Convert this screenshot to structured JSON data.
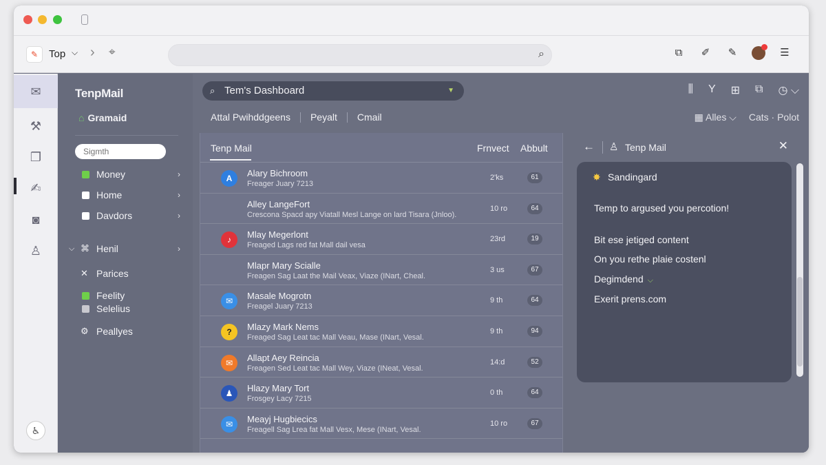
{
  "browser": {
    "tab_title": "Top",
    "tab_icon": "temp-mail-favicon",
    "url_value": ""
  },
  "sidebar": {
    "app_title": "TenpMail",
    "account": "Gramaid",
    "search_placeholder": "Sigmth",
    "items": [
      {
        "label": "Money",
        "color": "#6fcf4a"
      },
      {
        "label": "Home",
        "color": "#ffffff"
      },
      {
        "label": "Davdors",
        "color": "#ffffff"
      },
      {
        "label": "Henil"
      },
      {
        "label": "Parices"
      },
      {
        "label": "Feelity",
        "color": "#6fcf4a"
      },
      {
        "label": "Selelius",
        "color": "#c9c9cf"
      },
      {
        "label": "Peallyes"
      }
    ]
  },
  "header": {
    "dashboard": "Tem's Dashboard",
    "filters": [
      "Attal Pwihddgeens",
      "Peyalt",
      "Cmail"
    ],
    "right_filter": "Alles",
    "right_link": "Cats · Polot"
  },
  "list": {
    "title": "Tenp Mail",
    "col1": "Frnvect",
    "col2": "Abbult",
    "rows": [
      {
        "sender": "Alary Bichroom",
        "preview": "Freager Juary 7213",
        "time": "2'ks",
        "badge": "61",
        "avatar_color": "#2f7fe0",
        "avatar_text": "A"
      },
      {
        "sender": "Alley LangeFort",
        "preview": "Crescona Spacd apy Viatall Mesl Lange on lard Tisara (Jnloo).",
        "time": "10 ro",
        "badge": "64",
        "avatar_color": "",
        "avatar_text": ""
      },
      {
        "sender": "Mlay Megerlont",
        "preview": "Freaged Lags red fat Mall dail vesa",
        "time": "23rd",
        "badge": "19",
        "avatar_color": "#e0333a",
        "avatar_text": "♪"
      },
      {
        "sender": "Mlapr Mary Scialle",
        "preview": "Freagen Sag Laat the Mail Veax, Viaze (INart, Cheal.",
        "time": "3 us",
        "badge": "67",
        "avatar_color": "",
        "avatar_text": ""
      },
      {
        "sender": "Masale Mogrotn",
        "preview": "Freagel Juary 7213",
        "time": "9 th",
        "badge": "64",
        "avatar_color": "#3a8fe6",
        "avatar_text": "✉"
      },
      {
        "sender": "Mlazy Mark Nems",
        "preview": "Freaged Sag Leat tac Mall Veau, Mase (INart, Vesal.",
        "time": "9 th",
        "badge": "94",
        "avatar_color": "#f5c422",
        "avatar_text": "?"
      },
      {
        "sender": "Allapt Aey Reincia",
        "preview": "Freagen Sed Leat tac Mall Wey, Viaze (INeat, Vesal.",
        "time": "14:d",
        "badge": "52",
        "avatar_color": "#f07a2a",
        "avatar_text": "✉"
      },
      {
        "sender": "Hlazy Mary Tort",
        "preview": "Frosgey Lacy 7215",
        "time": "0 th",
        "badge": "64",
        "avatar_color": "#2a56b8",
        "avatar_text": "♟"
      },
      {
        "sender": "Meayj Hugbiecics",
        "preview": "Freagell Sag Lrea fat Mall Vesx, Mese (INart, Vesal.",
        "time": "10 ro",
        "badge": "67",
        "avatar_color": "#3a8fe6",
        "avatar_text": "✉"
      }
    ]
  },
  "detail": {
    "title": "Tenp Mail",
    "card": {
      "heading": "Sandingard",
      "line1": "Temp to argused you percotion!",
      "line2": "Bit ese jetiged content",
      "line3": "On you rethe plaie costenl",
      "line4": "Degimdend",
      "line5": "Exerit prens.com"
    }
  }
}
